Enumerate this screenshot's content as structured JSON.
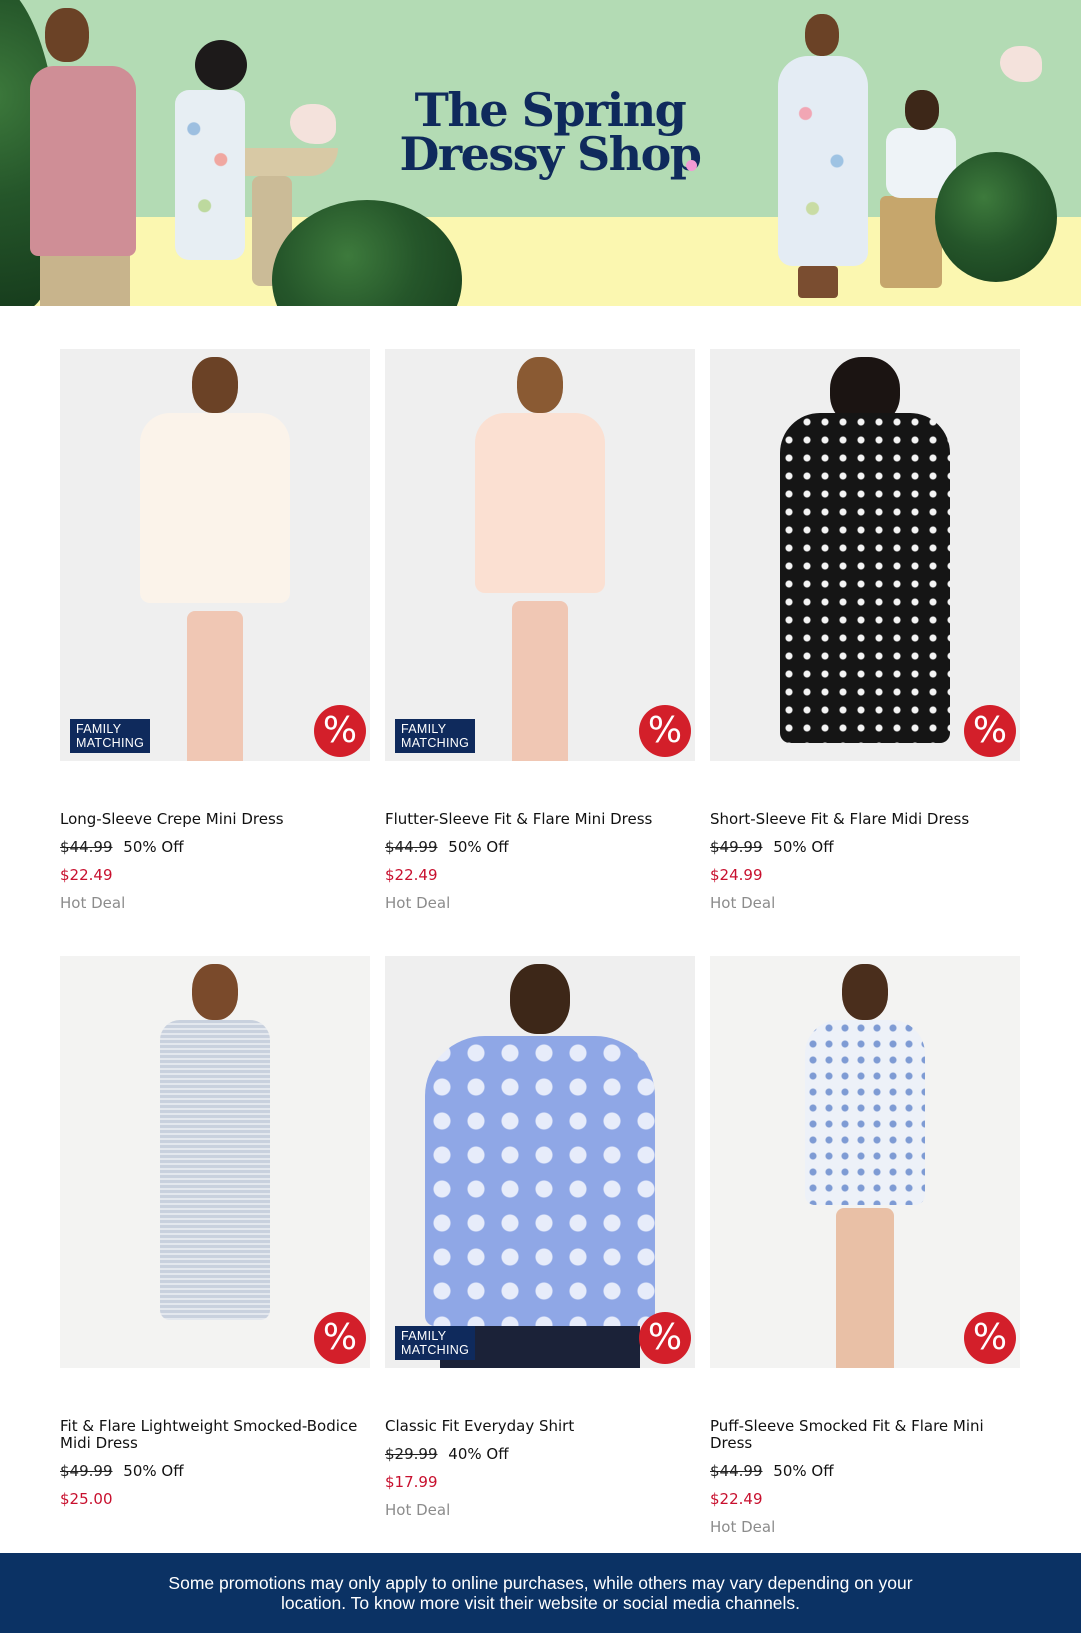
{
  "hero": {
    "title_line1": "The Spring",
    "title_line2": "Dressy Shop",
    "colors": {
      "sky": "#b3dbb4",
      "ground": "#fbf7b0",
      "title": "#0f2a5c"
    }
  },
  "badges": {
    "family_line1": "FAMILY",
    "family_line2": "MATCHING",
    "percent_symbol": "%"
  },
  "products": [
    {
      "name": "Long-Sleeve Crepe Mini Dress",
      "original_price": "$44.99",
      "discount": "50% Off",
      "sale_price": "$22.49",
      "deal": "Hot Deal",
      "family_matching": true,
      "image": "floral-long-sleeve-dress"
    },
    {
      "name": "Flutter-Sleeve Fit & Flare Mini Dress",
      "original_price": "$44.99",
      "discount": "50% Off",
      "sale_price": "$22.49",
      "deal": "Hot Deal",
      "family_matching": true,
      "image": "floral-flutter-dress"
    },
    {
      "name": "Short-Sleeve Fit & Flare Midi Dress",
      "original_price": "$49.99",
      "discount": "50% Off",
      "sale_price": "$24.99",
      "deal": "Hot Deal",
      "family_matching": false,
      "image": "polka-dot-midi-dress"
    },
    {
      "name": "Fit & Flare Lightweight Smocked-Bodice Midi Dress",
      "original_price": "$49.99",
      "discount": "50% Off",
      "sale_price": "$25.00",
      "deal": "",
      "family_matching": false,
      "image": "gingham-sleeveless-midi-dress"
    },
    {
      "name": "Classic Fit Everyday Shirt",
      "original_price": "$29.99",
      "discount": "40% Off",
      "sale_price": "$17.99",
      "deal": "Hot Deal",
      "family_matching": true,
      "image": "floral-blue-shirt"
    },
    {
      "name": "Puff-Sleeve Smocked Fit & Flare Mini Dress",
      "original_price": "$44.99",
      "discount": "50% Off",
      "sale_price": "$22.49",
      "deal": "Hot Deal",
      "family_matching": false,
      "image": "blue-print-puff-sleeve-dress"
    }
  ],
  "footer": {
    "text": "Some promotions may only apply to online purchases, while others may vary depending on your location. To know more visit their website or social media channels."
  },
  "colors": {
    "sale_red": "#c8102e",
    "badge_red": "#d31f2a",
    "navy": "#0f2a5c",
    "footer_bg": "#0b3264",
    "deal_gray": "#8c8c8c"
  }
}
